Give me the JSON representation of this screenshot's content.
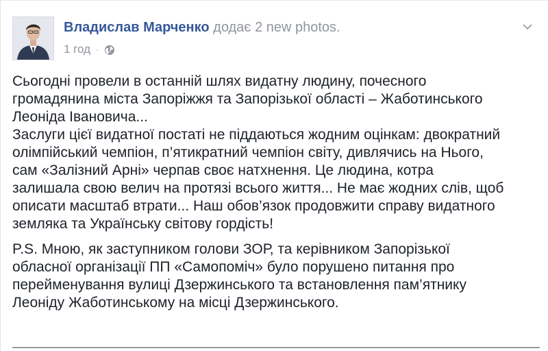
{
  "post": {
    "author_name": "Владислав Марченко",
    "action_text": "додає 2 new photos.",
    "timestamp": "1 год",
    "separator": "·",
    "privacy_icon": "globe-icon",
    "menu_icon": "chevron-down-icon",
    "paragraph_1_lines": [
      "Сьогодні провели в останній шлях видатну людину, почесного",
      "громадянина міста Запоріжжя та Запорізької області – Жаботинського",
      "Леоніда Івановича...",
      "Заслуги цієї видатної постаті не піддаються жодним оцінкам: двократний",
      "олімпійський чемпіон, п’ятикратний чемпіон світу, дивлячись на Нього,",
      "сам «Залізний Арні» черпав своє натхнення. Це людина, котра",
      "залишала свою велич на протязі всього життя... Не має жодних слів, щоб",
      "описати масштаб втрати... Наш обов’язок продовжити справу видатного",
      "земляка та Українську світову гордість!"
    ],
    "paragraph_2_lines": [
      "P.S. Мною, як заступником голови ЗОР, та керівником Запорізької",
      "обласної організації ПП «Самопоміч» було порушено питання про",
      "перейменування вулиці Дзержинського та встановлення пам’ятнику",
      "Леоніду Жаботинському на місці Дзержинського."
    ]
  },
  "colors": {
    "author_link": "#365899",
    "secondary_text": "#90949c",
    "body_text": "#1d2129"
  }
}
